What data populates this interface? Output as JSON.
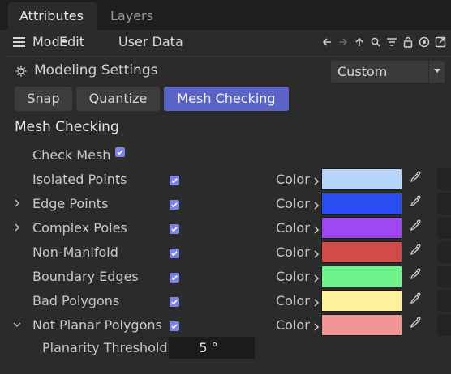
{
  "tabs": [
    {
      "label": "Attributes",
      "active": true
    },
    {
      "label": "Layers",
      "active": false
    }
  ],
  "menu": [
    "Mode",
    "Edit",
    "User Data"
  ],
  "toolbar_icons": [
    "arrow-left-icon",
    "arrow-right-icon",
    "arrow-up-icon",
    "search-icon",
    "filter-icon",
    "lock-icon",
    "target-icon",
    "new-window-icon"
  ],
  "settings": {
    "title": "Modeling Settings",
    "preset": "Custom"
  },
  "subtabs": [
    {
      "label": "Snap",
      "active": false
    },
    {
      "label": "Quantize",
      "active": false
    },
    {
      "label": "Mesh Checking",
      "active": true
    }
  ],
  "section_title": "Mesh Checking",
  "check_mesh": {
    "label": "Check Mesh",
    "checked": true
  },
  "checks": [
    {
      "label": "Isolated Points",
      "expander": "none",
      "checked": true,
      "color_label": "Color",
      "color": "#b6d4f7"
    },
    {
      "label": "Edge Points",
      "expander": "collapsed",
      "checked": true,
      "color_label": "Color",
      "color": "#2a4df0"
    },
    {
      "label": "Complex Poles",
      "expander": "collapsed",
      "checked": true,
      "color_label": "Color",
      "color": "#9f47f0"
    },
    {
      "label": "Non-Manifold",
      "expander": "none",
      "checked": true,
      "color_label": "Color",
      "color": "#d24a4a"
    },
    {
      "label": "Boundary Edges",
      "expander": "none",
      "checked": true,
      "color_label": "Color",
      "color": "#6ff28a"
    },
    {
      "label": "Bad Polygons",
      "expander": "none",
      "checked": true,
      "color_label": "Color",
      "color": "#fff09c"
    },
    {
      "label": "Not Planar Polygons",
      "expander": "expanded",
      "checked": true,
      "color_label": "Color",
      "color": "#f19494"
    }
  ],
  "threshold": {
    "label": "Planarity Threshold",
    "value": "5 °"
  },
  "accent_color": "#5b63c7"
}
